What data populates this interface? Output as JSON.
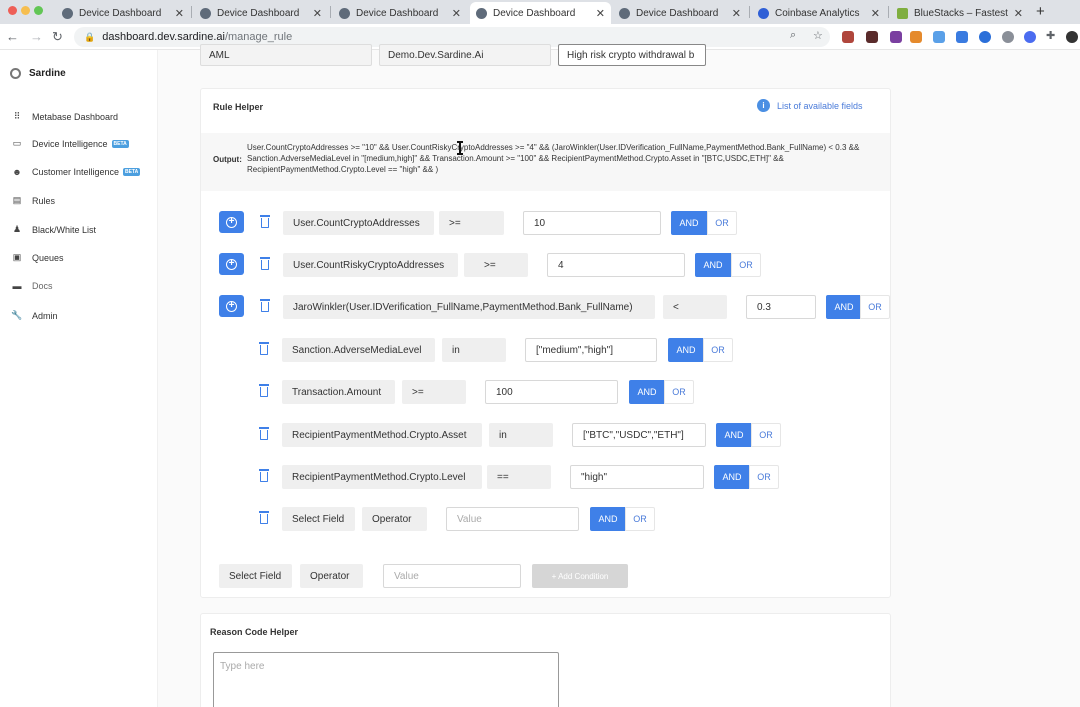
{
  "browser": {
    "tabs": [
      {
        "label": "Device Dashboard",
        "active": false
      },
      {
        "label": "Device Dashboard",
        "active": false
      },
      {
        "label": "Device Dashboard",
        "active": false
      },
      {
        "label": "Device Dashboard",
        "active": true
      },
      {
        "label": "Device Dashboard",
        "active": false
      },
      {
        "label": "Coinbase Analytics",
        "active": false
      },
      {
        "label": "BlueStacks – Fastest A",
        "active": false
      }
    ],
    "url_host": "dashboard.dev.sardine.ai",
    "url_path": "/manage_rule"
  },
  "sidebar": {
    "brand": "Sardine",
    "beta_label": "BETA",
    "items": [
      {
        "label": "Metabase Dashboard",
        "icon": "dot-icon"
      },
      {
        "label": "Device Intelligence",
        "icon": "laptop-icon",
        "beta": true
      },
      {
        "label": "Customer Intelligence",
        "icon": "people-icon",
        "beta": true
      },
      {
        "label": "Rules",
        "icon": "document-icon"
      },
      {
        "label": "Black/White List",
        "icon": "person-icon"
      },
      {
        "label": "Queues",
        "icon": "queue-icon"
      },
      {
        "label": "Docs",
        "icon": "book-icon"
      },
      {
        "label": "Admin",
        "icon": "wrench-icon"
      }
    ]
  },
  "top_fields": {
    "type": "AML",
    "client": "Demo.Dev.Sardine.Ai",
    "rule_name": "High risk crypto withdrawal b"
  },
  "rule_helper": {
    "title": "Rule Helper",
    "fields_link": "List of available fields",
    "output_label": "Output:",
    "output_text": "User.CountCryptoAddresses >= \"10\" && User.CountRiskyCryptoAddresses >= \"4\" && (JaroWinkler(User.IDVerification_FullName,PaymentMethod.Bank_FullName) < 0.3 && Sanction.AdverseMediaLevel in \"[medium,high]\" && Transaction.Amount >= \"100\" && RecipientPaymentMethod.Crypto.Asset in \"[BTC,USDC,ETH]\" && RecipientPaymentMethod.Crypto.Level == \"high\" && )",
    "and_label": "AND",
    "or_label": "OR",
    "conditions": [
      {
        "field": "User.CountCryptoAddresses",
        "operator": ">=",
        "value": "10"
      },
      {
        "field": "User.CountRiskyCryptoAddresses",
        "operator": ">=",
        "value": "4"
      },
      {
        "field": "JaroWinkler(User.IDVerification_FullName,PaymentMethod.Bank_FullName)",
        "operator": "<",
        "value": "0.3"
      },
      {
        "field": "Sanction.AdverseMediaLevel",
        "operator": "in",
        "value": "[\"medium\",\"high\"]"
      },
      {
        "field": "Transaction.Amount",
        "operator": ">=",
        "value": "100"
      },
      {
        "field": "RecipientPaymentMethod.Crypto.Asset",
        "operator": "in",
        "value": "[\"BTC\",\"USDC\",\"ETH\"]"
      },
      {
        "field": "RecipientPaymentMethod.Crypto.Level",
        "operator": "==",
        "value": "\"high\""
      },
      {
        "field": "Select Field",
        "operator": "Operator",
        "value_placeholder": "Value"
      }
    ],
    "new_condition": {
      "field": "Select Field",
      "operator": "Operator",
      "value_placeholder": "Value",
      "add_label": "+ Add Condition"
    }
  },
  "reason_code_helper": {
    "title": "Reason Code Helper",
    "placeholder": "Type here"
  }
}
